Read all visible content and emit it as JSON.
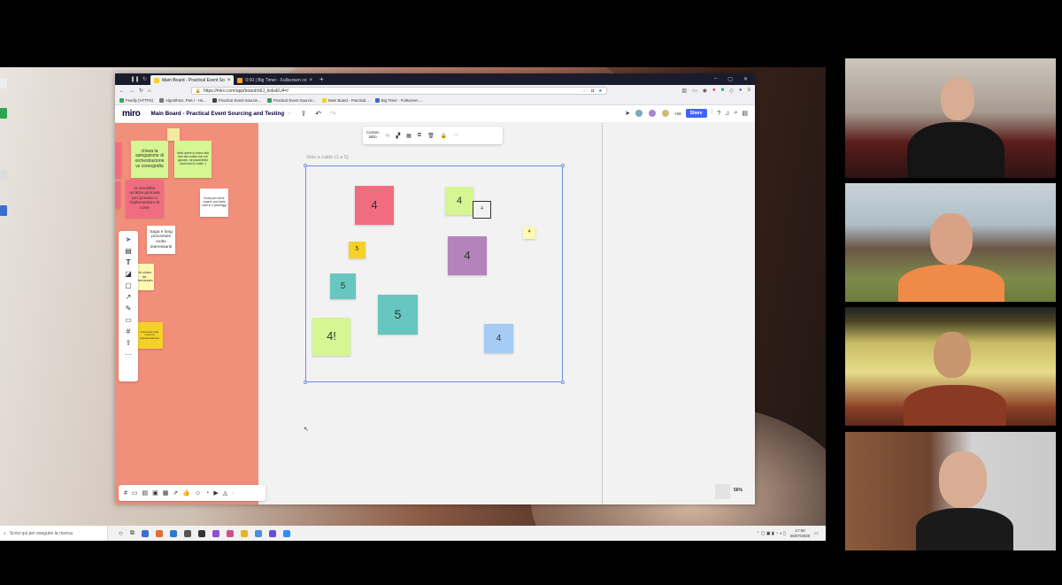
{
  "browser": {
    "tabs": [
      {
        "label": "Main Board - Practical Event So",
        "active": true
      },
      {
        "label": "0:00 | Big Timer - Fullscreen co",
        "active": false
      }
    ],
    "url": "https://miro.com/app/board/o9J_kokxEU4=/",
    "bookmarks": [
      "Feedly (HTTPS)",
      "Algorithms, Part I - Ho...",
      "Practical Event Sourcin...",
      "Practical Event Sourcin...",
      "Main Board - Practical...",
      "Big Timer - Fullscreen ..."
    ]
  },
  "miro": {
    "logo": "miro",
    "board_title": "Main Board - Practical Event Sourcing and Testing",
    "collaborators_more": "+10",
    "share_label": "Share",
    "zoom": "56%",
    "toolbar_custom_label": "Custom\ntablo",
    "frame_title": "Voto a caldo (1 a 5)"
  },
  "left_notes": [
    {
      "text": "chiara la spiegazione di orchestrazione vs coreografia"
    },
    {
      "text": "bello avere in mano alla fine del codice con cui giocare, mi piacerebbe riscriverlo in kotlin :)"
    },
    {
      "text": "io vorrebbe un'altra giornata per provare a implementare le cose"
    },
    {
      "text": "Kudos per avere coperto così tante cose in 4 pomeriggi"
    },
    {
      "text": "Saga e long processes molto interessanti"
    },
    {
      "text": "più chiaro da tokenizzare"
    },
    {
      "text": "individuare nella review la rappresentazione "
    }
  ],
  "vote_notes": [
    "4",
    "4",
    "4",
    "4",
    "5",
    "4",
    "5",
    "5",
    "4!",
    "4"
  ],
  "taskbar": {
    "search_placeholder": "Scrivi qui per eseguire la ricerca",
    "time": "17:50",
    "date": "26/07/2020"
  },
  "colors": {
    "frame_left": "#f28f7b",
    "share_button": "#4262ff",
    "note_red": "#f16c7f",
    "note_green": "#d5f692",
    "note_yellow": "#f5d128",
    "note_teal": "#67c6c0",
    "note_purple": "#b384bb",
    "note_blue": "#a6ccf5",
    "note_light_yellow": "#fff9b1"
  }
}
